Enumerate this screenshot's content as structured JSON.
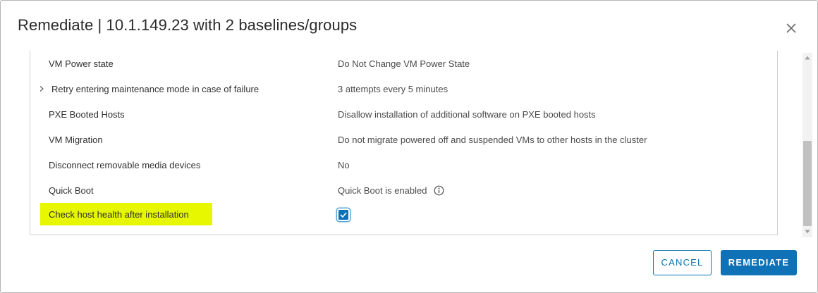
{
  "dialog": {
    "title": "Remediate | 10.1.149.23 with 2 baselines/groups",
    "close_icon": "close-icon"
  },
  "settings": [
    {
      "label": "VM Power state",
      "value": "Do Not Change VM Power State",
      "expandable": false
    },
    {
      "label": "Retry entering maintenance mode in case of failure",
      "value": "3 attempts every 5 minutes",
      "expandable": true
    },
    {
      "label": "PXE Booted Hosts",
      "value": "Disallow installation of additional software on PXE booted hosts",
      "expandable": false
    },
    {
      "label": "VM Migration",
      "value": "Do not migrate powered off and suspended VMs to other hosts in the cluster",
      "expandable": false
    },
    {
      "label": "Disconnect removable media devices",
      "value": "No",
      "expandable": false
    },
    {
      "label": "Quick Boot",
      "value": "Quick Boot is enabled",
      "expandable": false,
      "icon": "info-icon"
    },
    {
      "label": "Check host health after installation",
      "value": "",
      "expandable": false,
      "checkbox": true,
      "checked": true,
      "highlighted": true
    }
  ],
  "highlight_color": "#e6f700",
  "accent_color": "#0f72b6",
  "buttons": {
    "cancel_label": "CANCEL",
    "remediate_label": "REMEDIATE"
  }
}
